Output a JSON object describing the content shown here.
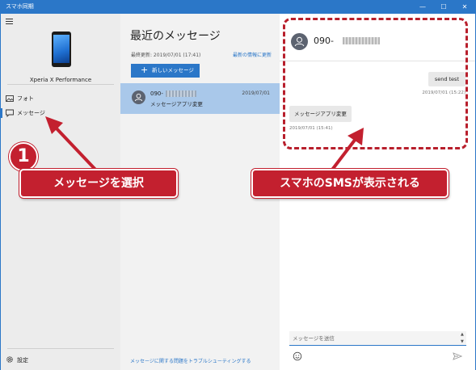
{
  "window": {
    "title": "スマホ同期",
    "controls": {
      "minimize": "—",
      "maximize": "☐",
      "close": "✕"
    }
  },
  "sidebar": {
    "device_name": "Xperia X Performance",
    "items": [
      {
        "label": "フォト",
        "icon": "photo-icon"
      },
      {
        "label": "メッセージ",
        "icon": "chat-icon"
      }
    ],
    "settings_label": "設定"
  },
  "messages": {
    "title": "最近のメッセージ",
    "last_updated": "最終更新: 2019/07/01 (17:41)",
    "refresh_link": "最新の情報に更新",
    "new_message_label": "新しいメッセージ",
    "conversations": [
      {
        "name": "090-",
        "date": "2019/07/01",
        "preview": "メッセージアプリ変更"
      }
    ],
    "troubleshoot_link": "メッセージに関する問題をトラブルシューティングする"
  },
  "thread": {
    "contact": "090-",
    "outgoing": {
      "text": "send test",
      "time": "2019/07/01 (15:22)"
    },
    "incoming": {
      "text": "メッセージアプリ変更",
      "time": "2019/07/01 (15:41)"
    },
    "compose_placeholder": "メッセージを送信"
  },
  "annotations": {
    "step_number": "1",
    "select_label": "メッセージを選択",
    "sms_label": "スマホのSMSが表示される",
    "accent": "#c3202f"
  },
  "colors": {
    "accent": "#2b77c8",
    "selected_row": "#a9c8ea"
  }
}
